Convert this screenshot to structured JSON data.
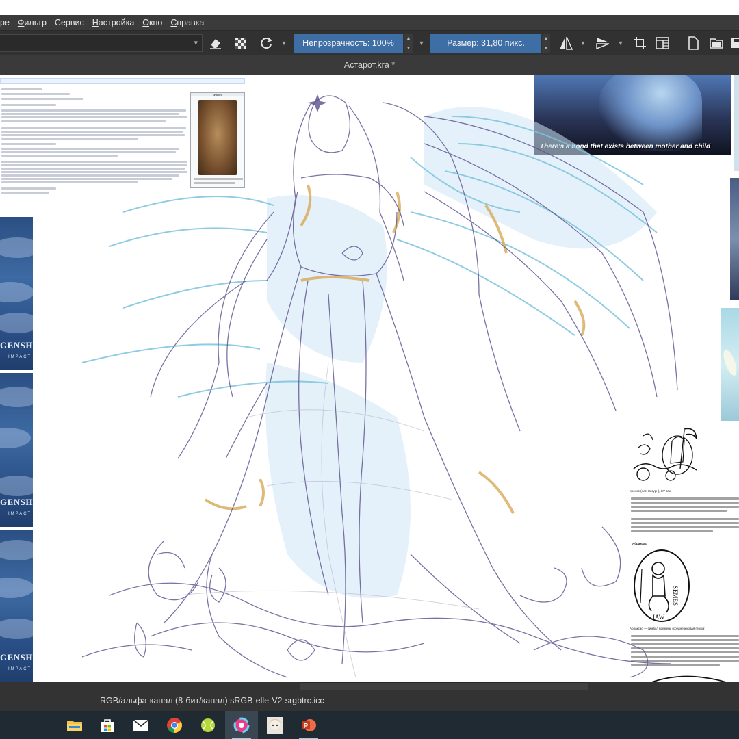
{
  "app": {
    "document_title": "Астарот.kra *"
  },
  "menu": {
    "items": [
      {
        "pre": "",
        "u": "",
        "label": "ре"
      },
      {
        "pre": "",
        "u": "Ф",
        "post": "ильтр"
      },
      {
        "pre": "",
        "u": "С",
        "post": "ервис"
      },
      {
        "pre": "",
        "u": "Н",
        "post": "астройка"
      },
      {
        "pre": "",
        "u": "О",
        "post": "кно"
      },
      {
        "pre": "",
        "u": "С",
        "post": "правка"
      }
    ]
  },
  "toolbar": {
    "opacity_label": "Непрозрачность: 100%",
    "size_label": "Размер: 31,80 пикс."
  },
  "canvas": {
    "ref_caption": "There's a bond that exists between mother and child",
    "genshin_logo": "GENSHIN",
    "genshin_sub": "IMPACT",
    "wiki_infobox_caption": "Фарот",
    "abraxas_caption": "Абраксас",
    "seal_text": "IAW SEMES"
  },
  "statusbar": {
    "color_info": "RGB/альфа-канал (8-бит/канал)  sRGB-elle-V2-srgbtrc.icc"
  },
  "taskbar": {
    "icons": [
      "file-explorer-icon",
      "store-icon",
      "mail-icon",
      "chrome-icon",
      "tennis-app-icon",
      "krita-icon",
      "character-avatar-icon",
      "powerpoint-icon"
    ]
  },
  "colors": {
    "menubar": "#3b3b3b",
    "toolbar": "#313131",
    "slider_accent": "#3d6ea6",
    "taskbar": "#1f2a33"
  }
}
